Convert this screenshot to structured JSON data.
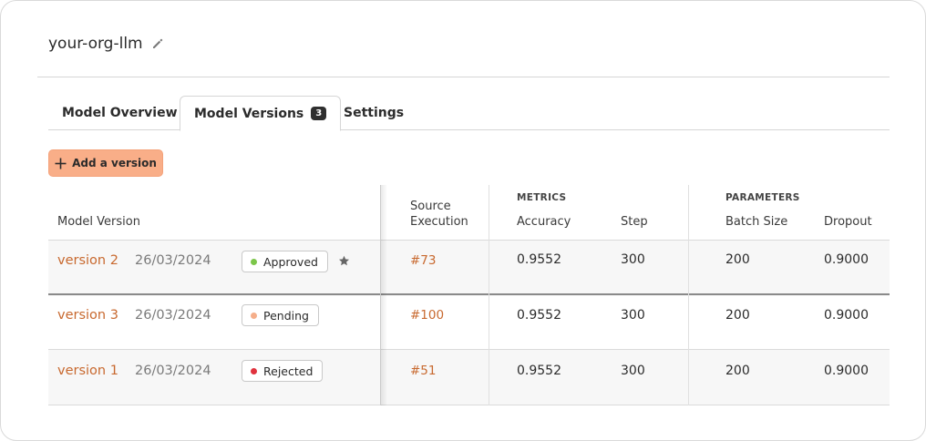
{
  "project": {
    "title": "your-org-llm",
    "edit_icon": "pencil-icon"
  },
  "tabs": [
    {
      "label": "Model Overview",
      "active": false
    },
    {
      "label": "Model Versions",
      "badge": "3",
      "active": true
    },
    {
      "label": "Settings",
      "active": false
    }
  ],
  "actions": {
    "add_version_label": "Add a version",
    "add_icon": "plus-icon"
  },
  "table": {
    "headers": {
      "model_version": "Model Version",
      "source_execution_line1": "Source",
      "source_execution_line2": "Execution",
      "metrics_group": "METRICS",
      "accuracy": "Accuracy",
      "step": "Step",
      "parameters_group": "PARAMETERS",
      "batch_size": "Batch Size",
      "dropout": "Dropout"
    },
    "rows": [
      {
        "version": "version 2",
        "date": "26/03/2024",
        "status": "Approved",
        "status_color": "#7cc64a",
        "starred": true,
        "execution": "#73",
        "accuracy": "0.9552",
        "step": "300",
        "batch_size": "200",
        "dropout": "0.9000"
      },
      {
        "version": "version 3",
        "date": "26/03/2024",
        "status": "Pending",
        "status_color": "#f5ae8a",
        "starred": false,
        "execution": "#100",
        "accuracy": "0.9552",
        "step": "300",
        "batch_size": "200",
        "dropout": "0.9000"
      },
      {
        "version": "version 1",
        "date": "26/03/2024",
        "status": "Rejected",
        "status_color": "#e0323e",
        "starred": false,
        "execution": "#51",
        "accuracy": "0.9552",
        "step": "300",
        "batch_size": "200",
        "dropout": "0.9000"
      }
    ]
  },
  "colors": {
    "accent": "#c8692f",
    "button_bg": "#f9ae88"
  }
}
